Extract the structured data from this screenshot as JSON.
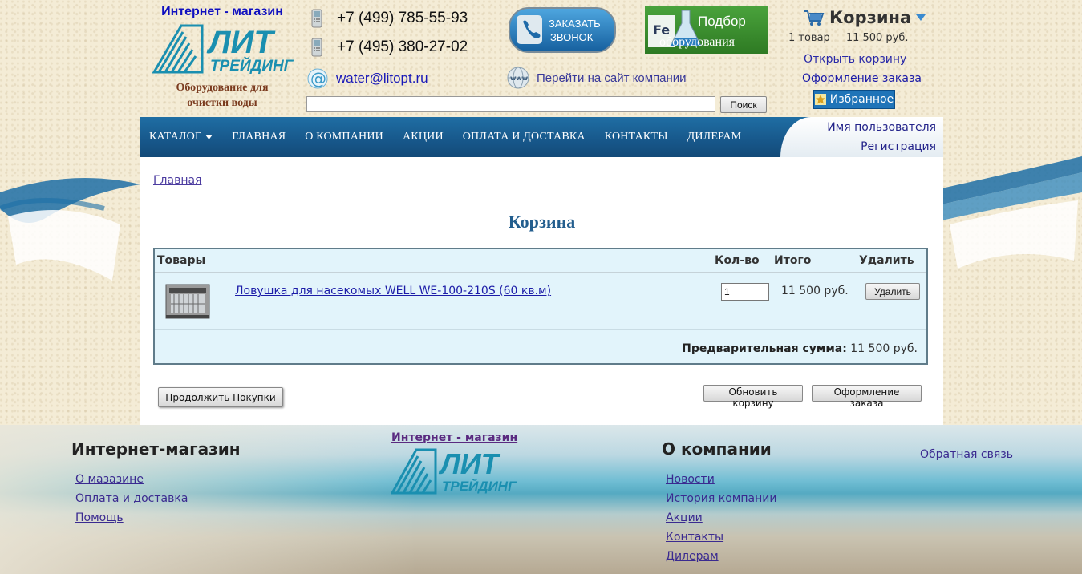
{
  "header": {
    "logo_top": "Интернет - магазин",
    "logo_main": "ЛИТ",
    "logo_sub": "ТРЕЙДИНГ",
    "tagline_1": "Оборудование для",
    "tagline_2": "очистки воды",
    "phone_1": "+7 (499) 785-55-93",
    "phone_2": "+7 (495) 380-27-02",
    "email": "water@litopt.ru",
    "call_button_line1": "ЗАКАЗАТЬ",
    "call_button_line2": "ЗВОНОК",
    "select_button_line1": "Подбор",
    "select_button_line2": "оборудования",
    "select_badge": "Fe",
    "site_link": "Перейти на сайт компании",
    "site_icon_text": "www",
    "search_placeholder": "",
    "search_button": "Поиск"
  },
  "cart_widget": {
    "title": "Корзина",
    "items_count": "1 товар",
    "total": "11 500 руб.",
    "open_cart": "Открыть корзину",
    "checkout": "Оформление заказа",
    "favorites": "Избранное"
  },
  "nav": {
    "items": [
      "КАТАЛОГ",
      "ГЛАВНАЯ",
      "О КОМПАНИИ",
      "АКЦИИ",
      "ОПЛАТА И ДОСТАВКА",
      "КОНТАКТЫ",
      "ДИЛЕРАМ"
    ],
    "username": "Имя пользователя",
    "register": "Регистрация"
  },
  "content": {
    "breadcrumb": "Главная",
    "page_title": "Корзина",
    "columns": {
      "products": "Товары",
      "qty": "Кол-во",
      "total": "Итого",
      "delete": "Удалить"
    },
    "rows": [
      {
        "name": "Ловушка для насекомых WELL WE-100-210S (60 кв.м)",
        "qty": "1",
        "price": "11 500 руб.",
        "delete_label": "Удалить"
      }
    ],
    "subtotal_label": "Предварительная сумма:",
    "subtotal_value": "11 500 руб.",
    "continue_button": "Продолжить Покупки",
    "update_button": "Обновить корзину",
    "checkout_button": "Оформление заказа"
  },
  "footer": {
    "shop_heading": "Интернет-магазин",
    "shop_links": [
      "О мазазине",
      "Оплата и доставка",
      "Помощь"
    ],
    "logo_top": "Интернет - магазин",
    "company_heading": "О компании",
    "company_links": [
      "Новости",
      "История компании",
      "Акции",
      "Контакты",
      "Дилерам"
    ],
    "feedback": "Обратная связь"
  },
  "colors": {
    "nav_bg": "#17578a",
    "cart_table_bg": "#e2f4fb",
    "title": "#235e8e",
    "link": "#1c1ca8"
  }
}
